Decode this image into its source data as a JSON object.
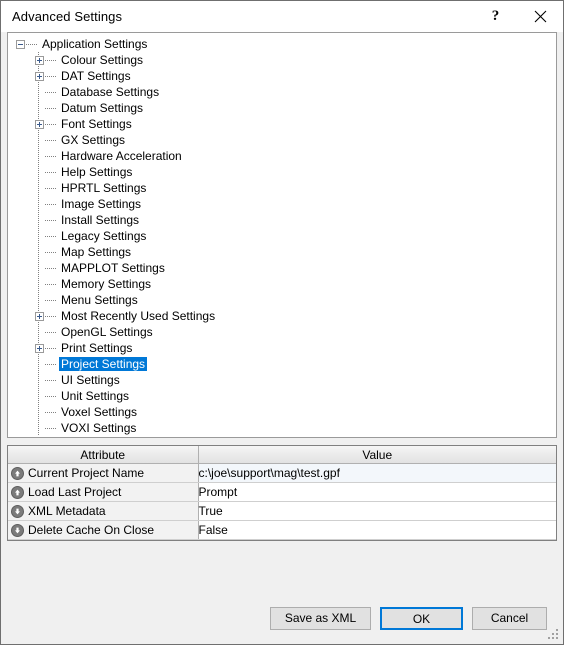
{
  "window": {
    "title": "Advanced Settings",
    "help_label": "?",
    "close_label": "Close"
  },
  "tree": {
    "nodes": [
      {
        "label": "Application Settings",
        "depth": 0,
        "state": "expanded",
        "selected": false
      },
      {
        "label": "Colour Settings",
        "depth": 1,
        "state": "collapsed",
        "selected": false
      },
      {
        "label": "DAT Settings",
        "depth": 1,
        "state": "collapsed",
        "selected": false
      },
      {
        "label": "Database Settings",
        "depth": 1,
        "state": "leaf",
        "selected": false
      },
      {
        "label": "Datum Settings",
        "depth": 1,
        "state": "leaf",
        "selected": false
      },
      {
        "label": "Font Settings",
        "depth": 1,
        "state": "collapsed",
        "selected": false
      },
      {
        "label": "GX Settings",
        "depth": 1,
        "state": "leaf",
        "selected": false
      },
      {
        "label": "Hardware Acceleration",
        "depth": 1,
        "state": "leaf",
        "selected": false
      },
      {
        "label": "Help Settings",
        "depth": 1,
        "state": "leaf",
        "selected": false
      },
      {
        "label": "HPRTL Settings",
        "depth": 1,
        "state": "leaf",
        "selected": false
      },
      {
        "label": "Image Settings",
        "depth": 1,
        "state": "leaf",
        "selected": false
      },
      {
        "label": "Install Settings",
        "depth": 1,
        "state": "leaf",
        "selected": false
      },
      {
        "label": "Legacy Settings",
        "depth": 1,
        "state": "leaf",
        "selected": false
      },
      {
        "label": "Map Settings",
        "depth": 1,
        "state": "leaf",
        "selected": false
      },
      {
        "label": "MAPPLOT Settings",
        "depth": 1,
        "state": "leaf",
        "selected": false
      },
      {
        "label": "Memory Settings",
        "depth": 1,
        "state": "leaf",
        "selected": false
      },
      {
        "label": "Menu Settings",
        "depth": 1,
        "state": "leaf",
        "selected": false
      },
      {
        "label": "Most Recently Used Settings",
        "depth": 1,
        "state": "collapsed",
        "selected": false
      },
      {
        "label": "OpenGL Settings",
        "depth": 1,
        "state": "leaf",
        "selected": false
      },
      {
        "label": "Print Settings",
        "depth": 1,
        "state": "collapsed",
        "selected": false
      },
      {
        "label": "Project Settings",
        "depth": 1,
        "state": "leaf",
        "selected": true
      },
      {
        "label": "UI Settings",
        "depth": 1,
        "state": "leaf",
        "selected": false
      },
      {
        "label": "Unit Settings",
        "depth": 1,
        "state": "leaf",
        "selected": false
      },
      {
        "label": "Voxel Settings",
        "depth": 1,
        "state": "leaf",
        "selected": false
      },
      {
        "label": "VOXI Settings",
        "depth": 1,
        "state": "leaf",
        "selected": false
      }
    ]
  },
  "table": {
    "columns": [
      "Attribute",
      "Value"
    ],
    "rows": [
      {
        "icon": "up-arrow-badge-icon",
        "attribute": "Current Project Name",
        "value": "c:\\joe\\support\\mag\\test.gpf",
        "selected": true
      },
      {
        "icon": "up-arrow-badge-icon",
        "attribute": "Load Last Project",
        "value": "Prompt",
        "selected": false
      },
      {
        "icon": "down-arrow-badge-icon",
        "attribute": "XML Metadata",
        "value": "True",
        "selected": false
      },
      {
        "icon": "down-arrow-badge-icon",
        "attribute": "Delete Cache On Close",
        "value": "False",
        "selected": false
      }
    ]
  },
  "footer": {
    "save_as_xml_label": "Save as XML",
    "ok_label": "OK",
    "cancel_label": "Cancel"
  },
  "colors": {
    "selection_blue": "#0078d7",
    "dialog_background": "#f0f0f0",
    "panel_background": "#ffffff"
  }
}
